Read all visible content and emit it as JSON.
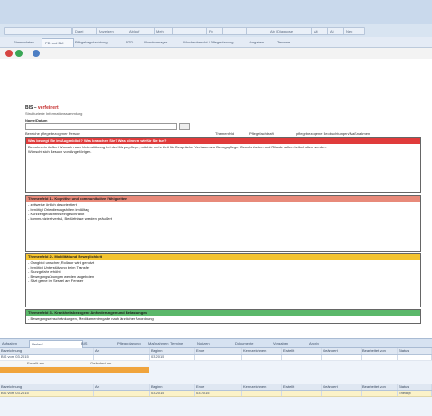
{
  "colors": {
    "red_section": "#e03b3b",
    "salmon_section": "#e88a7a",
    "yellow_section": "#f4c430",
    "green_section": "#5bb86a",
    "orange_bar": "#f0a43c",
    "title_bar": "#c9d9ec"
  },
  "toolbar": {
    "items": [
      "",
      "Datei",
      "Anzeigen",
      "Ablauf",
      "Mehr",
      "",
      "Fb",
      "",
      "",
      "Ab | Diagnose",
      "Alt",
      "Alt",
      "Neu"
    ]
  },
  "tabs": [
    "",
    "Stammdaten",
    "PD und BM",
    "Pflegebegutachtung",
    "NTD",
    "Wundmanager",
    "Wochenbericht / Pflegeplanung",
    "Vorgaben",
    "Termine"
  ],
  "breadcrumb": "",
  "doc": {
    "title": "BIS",
    "title_badge": "verfeinert",
    "subtitle": "Strukturierte Informationssammlung",
    "field_label": "Name/Datum",
    "columns": [
      "Bereiche pflegebezogener Person",
      "Themenfeld",
      "Pflegefachkraft",
      "pflegebezogene Beobachtungen/Maßnahmen"
    ]
  },
  "sections": [
    {
      "color": "#e03b3b",
      "text_color": "#ffffff",
      "head": "Was bewegt Sie im Augenblick? Was brauchen Sie? Was können wir für Sie tun?",
      "lines": [
        "Bewohnerin äußert Wunsch nach Unterstützung bei der Körperpflege, möchte mehr Zeit für Gespräche, Vertrauen zu Bezugspflege, Gewohnheiten und Rituale sollen beibehalten werden.",
        "Wünscht sich Besuch von Angehörigen."
      ],
      "height": 59
    },
    {
      "color": "#e88a7a",
      "text_color": "#1a1a1a",
      "head": "Themenfeld 1 - Kognitive und kommunikative Fähigkeiten",
      "lines": [
        "- zeitweise örtlich desorientiert",
        "- benötigt Orientierungshilfen im Alltag",
        "- Kurzzeitgedächtnis eingeschränkt",
        "- kommuniziert verbal, Bedürfnisse werden geäußert"
      ],
      "height": 61
    },
    {
      "color": "#f4c430",
      "text_color": "#1a1a1a",
      "head": "Themenfeld 2 - Mobilität und Beweglichkeit",
      "lines": [
        "- Gangbild unsicher, Rollator wird genutzt",
        "- benötigt Unterstützung beim Transfer",
        "- Sturzgefahr erhöht",
        "- Bewegungsübungen werden angeboten",
        "- Sitzt gerne im Sessel am Fenster"
      ],
      "height": 58
    },
    {
      "color": "#5bb86a",
      "text_color": "#1a1a1a",
      "head": "Themenfeld 3 - Krankheitsbezogene Anforderungen und Belastungen",
      "lines": [
        "- Bewegungseinschränkungen, Medikamentengabe nach ärztlicher Anordnung"
      ],
      "height": 14
    }
  ],
  "bottom": {
    "tabs": [
      "Aufgaben",
      "Verlauf",
      "BIS",
      "Pflegeplanung",
      "Maßnahmen",
      "Termine",
      "Notizen",
      "Dokumente",
      "Vorgaben",
      "Archiv"
    ],
    "grid1_headers": [
      "Bezeichnung",
      "Art",
      "Beginn",
      "Ende",
      "Kennzeichnen",
      "Erstellt",
      "Geändert",
      "Bearbeitet von",
      "Status"
    ],
    "grid1_row": [
      "BIS vom 03.2015",
      "",
      "03.2015",
      "",
      "",
      "",
      "",
      "",
      ""
    ],
    "sub_labels": [
      "Erstellt am",
      "Geändert am"
    ],
    "grid2_headers": [
      "Bezeichnung",
      "Art",
      "Beginn",
      "Ende",
      "Kennzeichnen",
      "Erstellt",
      "Geändert",
      "Bearbeitet von",
      "Status"
    ],
    "grid2_row": [
      "BIS vom 03.2015",
      "",
      "03.2015",
      "03.2015",
      "",
      "",
      "",
      "",
      "Erledigt"
    ]
  }
}
